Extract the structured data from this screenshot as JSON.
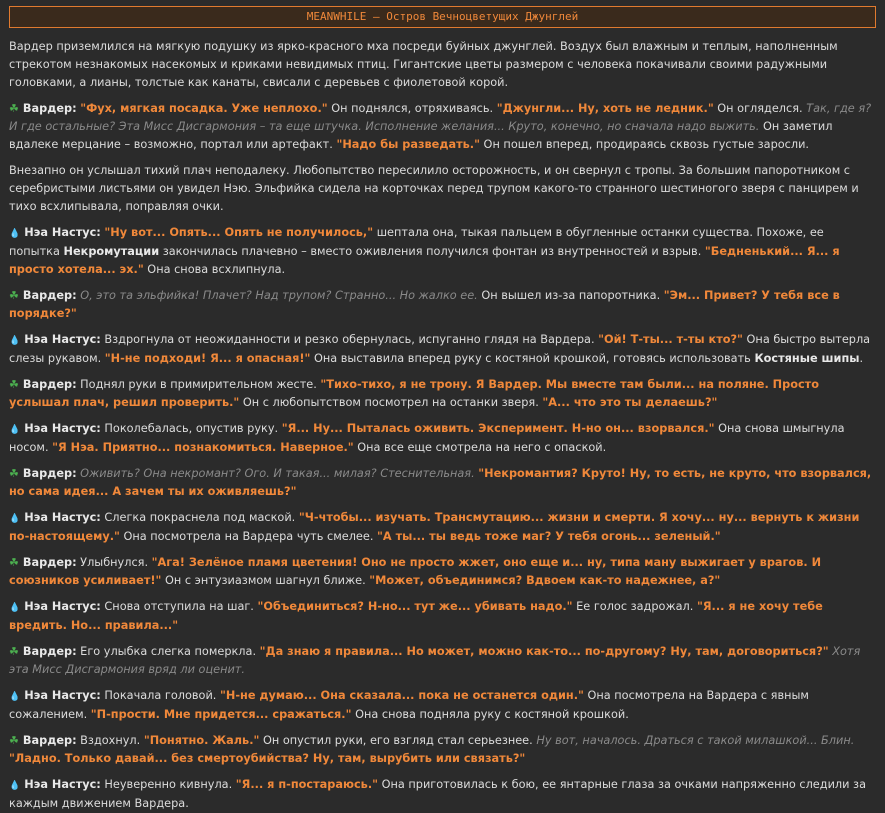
{
  "header": {
    "title": "MEANWHILE – Остров Вечноцветущих Джунглей"
  },
  "colors": {
    "accent": "#f0883a",
    "thought": "#8a8a8a",
    "vardar_icon": "#4cb050",
    "nea_icon": "#5aa5e6"
  },
  "icons": {
    "vardar": "leaf-icon",
    "nea": "droplets-icon"
  },
  "narrative": {
    "intro": "Вардер приземлился на мягкую подушку из ярко-красного мха посреди буйных джунглей. Воздух был влажным и теплым, наполненным стрекотом незнакомых насекомых и криками невидимых птиц. Гигантские цветы размером с человека покачивали своими радужными головками, а лианы, толстые как канаты, свисали с деревьев с фиолетовой корой.",
    "cry": "Внезапно он услышал тихий плач неподалеку. Любопытство пересилило осторожность, и он свернул с тропы. За большим папоротником с серебристыми листьями он увидел Нэю. Эльфийка сидела на корточках перед трупом какого-то странного шестиногого зверя с панцирем и тихо всхлипывала, поправляя очки."
  },
  "p1": {
    "name": "Вардер:",
    "q1": "\"Фух, мягкая посадка. Уже неплохо.\"",
    "t1": " Он поднялся, отряхиваясь. ",
    "q2": "\"Джунгли... Ну, хоть не ледник.\"",
    "t2": " Он огляделся. ",
    "th": "Так, где я? И где остальные? Эта Мисс Дисгармония – та еще штучка. Исполнение желания... Круто, конечно, но сначала надо выжить.",
    "t3": " Он заметил вдалеке мерцание – возможно, портал или артефакт. ",
    "q3": "\"Надо бы разведать.\"",
    "t4": " Он пошел вперед, продираясь сквозь густые заросли."
  },
  "p2": {
    "name": "Нэа Настус:",
    "q1": "\"Ну вот... Опять... Опять не получилось,\"",
    "t1": " шептала она, тыкая пальцем в обугленные останки существа. Похоже, ее попытка ",
    "b1": "Некромутации",
    "t2": " закончилась плачевно – вместо оживления получился фонтан из внутренностей и взрыв. ",
    "q2": "\"Бедненький... Я... я просто хотела... эх.\"",
    "t3": " Она снова всхлипнула."
  },
  "p3": {
    "name": "Вардер:",
    "th": "О, это та эльфийка! Плачет? Над трупом? Странно... Но жалко ее.",
    "t1": " Он вышел из-за папоротника. ",
    "q1": "\"Эм... Привет? У тебя все в порядке?\""
  },
  "p4": {
    "name": "Нэа Настус:",
    "t1": " Вздрогнула от неожиданности и резко обернулась, испуганно глядя на Вардера. ",
    "q1": "\"Ой! Т-ты... т-ты кто?\"",
    "t2": " Она быстро вытерла слезы рукавом. ",
    "q2": "\"Н-не подходи! Я... я опасная!\"",
    "t3": " Она выставила вперед руку с костяной крошкой, готовясь использовать ",
    "b1": "Костяные шипы",
    "t4": "."
  },
  "p5": {
    "name": "Вардер:",
    "t1": " Поднял руки в примирительном жесте. ",
    "q1": "\"Тихо-тихо, я не трону. Я Вардер. Мы вместе там были... на поляне. Просто услышал плач, решил проверить.\"",
    "t2": " Он с любопытством посмотрел на останки зверя. ",
    "q2": "\"А... что это ты делаешь?\""
  },
  "p6": {
    "name": "Нэа Настус:",
    "t1": " Поколебалась, опустив руку. ",
    "q1": "\"Я... Ну... Пыталась оживить. Эксперимент. Н-но он... взорвался.\"",
    "t2": " Она снова шмыгнула носом. ",
    "q2": "\"Я Нэа. Приятно... познакомиться. Наверное.\"",
    "t3": " Она все еще смотрела на него с опаской."
  },
  "p7": {
    "name": "Вардер:",
    "th": " Оживить? Она некромант? Ого. И такая... милая? Стеснительная. ",
    "q1": "\"Некромантия? Круто! Ну, то есть, не круто, что взорвался, но сама идея... А зачем ты их оживляешь?\""
  },
  "p8": {
    "name": "Нэа Настус:",
    "t1": " Слегка покраснела под маской. ",
    "q1": "\"Ч-чтобы... изучать. Трансмутацию... жизни и смерти. Я хочу... ну... вернуть к жизни по-настоящему.\"",
    "t2": " Она посмотрела на Вардера чуть смелее. ",
    "q2": "\"А ты... ты ведь тоже маг? У тебя огонь... зеленый.\""
  },
  "p9": {
    "name": "Вардер:",
    "t1": " Улыбнулся. ",
    "q1": "\"Ага! ",
    "b1": "Зелёное пламя цветения",
    "q2": "! Оно не просто жжет, оно еще и... ну, типа ману выжигает у врагов. И союзников усиливает!\"",
    "t2": " Он с энтузиазмом шагнул ближе. ",
    "q3": "\"Может, объединимся? Вдвоем как-то надежнее, а?\""
  },
  "p10": {
    "name": "Нэа Настус:",
    "t1": " Снова отступила на шаг. ",
    "q1": "\"Объединиться? Н-но... тут же... убивать надо.\"",
    "t2": " Ее голос задрожал. ",
    "q2": "\"Я... я не хочу тебе вредить. Но... правила...\""
  },
  "p11": {
    "name": "Вардер:",
    "t1": " Его улыбка слегка померкла. ",
    "q1": "\"Да знаю я правила... Но может, можно как-то... по-другому? Ну, там, договориться?\"",
    "th": " Хотя эта Мисс Дисгармония вряд ли оценит."
  },
  "p12": {
    "name": "Нэа Настус:",
    "t1": " Покачала головой. ",
    "q1": "\"Н-не думаю... Она сказала... пока не останется один.\"",
    "t2": " Она посмотрела на Вардера с явным сожалением. ",
    "q2": "\"П-прости. Мне придется... сражаться.\"",
    "t3": " Она снова подняла руку с костяной крошкой."
  },
  "p13": {
    "name": "Вардер:",
    "t1": " Вздохнул. ",
    "q1": "\"Понятно. Жаль.\"",
    "t2": " Он опустил руки, его взгляд стал серьезнее. ",
    "th": "Ну вот, началось. Драться с такой милашкой... Блин.",
    "t3": " ",
    "q2": "\"Ладно. Только давай... без смертоубийства? Ну, там, вырубить или связать?\""
  },
  "p14": {
    "name": "Нэа Настус:",
    "t1": " Неуверенно кивнула. ",
    "q1": "\"Я... я п-постараюсь.\"",
    "t2": " Она приготовилась к бою, ее янтарные глаза за очками напряженно следили за каждым движением Вардера."
  }
}
